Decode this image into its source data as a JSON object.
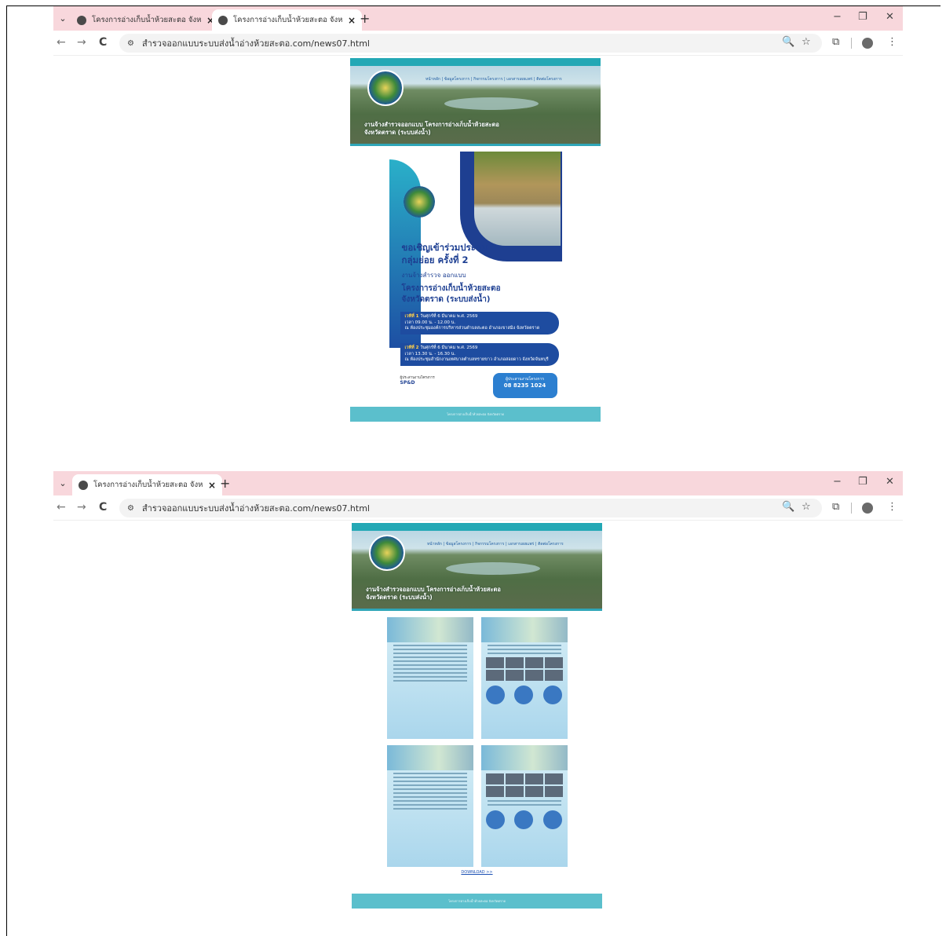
{
  "browser": {
    "tab_inactive_title": "โครงการอ่างเก็บน้ำห้วยสะตอ จังหวัดตราด",
    "tab_active_title": "โครงการอ่างเก็บน้ำห้วยสะตอ จังหวัดตราด",
    "url": "สำรวจออกแบบระบบส่งน้ำอ่างห้วยสะตอ.com/news07.html",
    "new_tab": "+",
    "close": "×",
    "dropdown": "⌄",
    "back": "←",
    "forward": "→",
    "reload": "C",
    "tune": "⚙",
    "zoom": "🔍",
    "star": "☆",
    "extensions": "⧉",
    "menu": "⋮",
    "minimize": "−",
    "restore": "❐",
    "window_close": "✕"
  },
  "site": {
    "menu": "หน้าหลัก | ข้อมูลโครงการ | กิจกรรมโครงการ | เอกสารเผยแพร่ | ติดต่อโครงการ",
    "banner_line1": "งานจ้างสำรวจออกแบบ โครงการอ่างเก็บน้ำห้วยสะตอ",
    "banner_line2": "จังหวัดตราด (ระบบส่งน้ำ)",
    "footer": "โครงการอ่างเก็บน้ำห้วยสะตอ จังหวัดตราด"
  },
  "poster": {
    "title_line1": "ขอเชิญเข้าร่วมประชุม",
    "title_line2": "กลุ่มย่อย ครั้งที่ 2",
    "subtitle": "งานจ้างสำรวจ ออกแบบ",
    "project_line1": "โครงการอ่างเก็บน้ำห้วยสะตอ",
    "project_line2": "จังหวัดตราด (ระบบส่งน้ำ)",
    "session1_label": "เวทีที่ 1",
    "session1_date": "วันศุกร์ที่ 6 มีนาคม พ.ศ. 2569",
    "session1_time": "เวลา 09.00 น. - 12.00 น.",
    "session1_place": "ณ ห้องประชุมองค์การบริหารส่วนตำบลสะตอ อำเภอเขาสมิง จังหวัดตราด",
    "session2_label": "เวทีที่ 2",
    "session2_date": "วันศุกร์ที่ 6 มีนาคม พ.ศ. 2569",
    "session2_time": "เวลา 13.30 น. - 16.30 น.",
    "session2_place": "ณ ห้องประชุมสำนักงานเทศบาลตำบลทรายขาว อำเภอสอยดาว จังหวัดจันทบุรี",
    "consultant_label": "ผู้ประสานงานโครงการ",
    "consultant_logo": "SP&D",
    "contact_label": "ผู้ประสานงานโครงการ",
    "contact_phone": "08 8235 1024"
  },
  "download": {
    "label": "DOWNLOAD >>"
  }
}
